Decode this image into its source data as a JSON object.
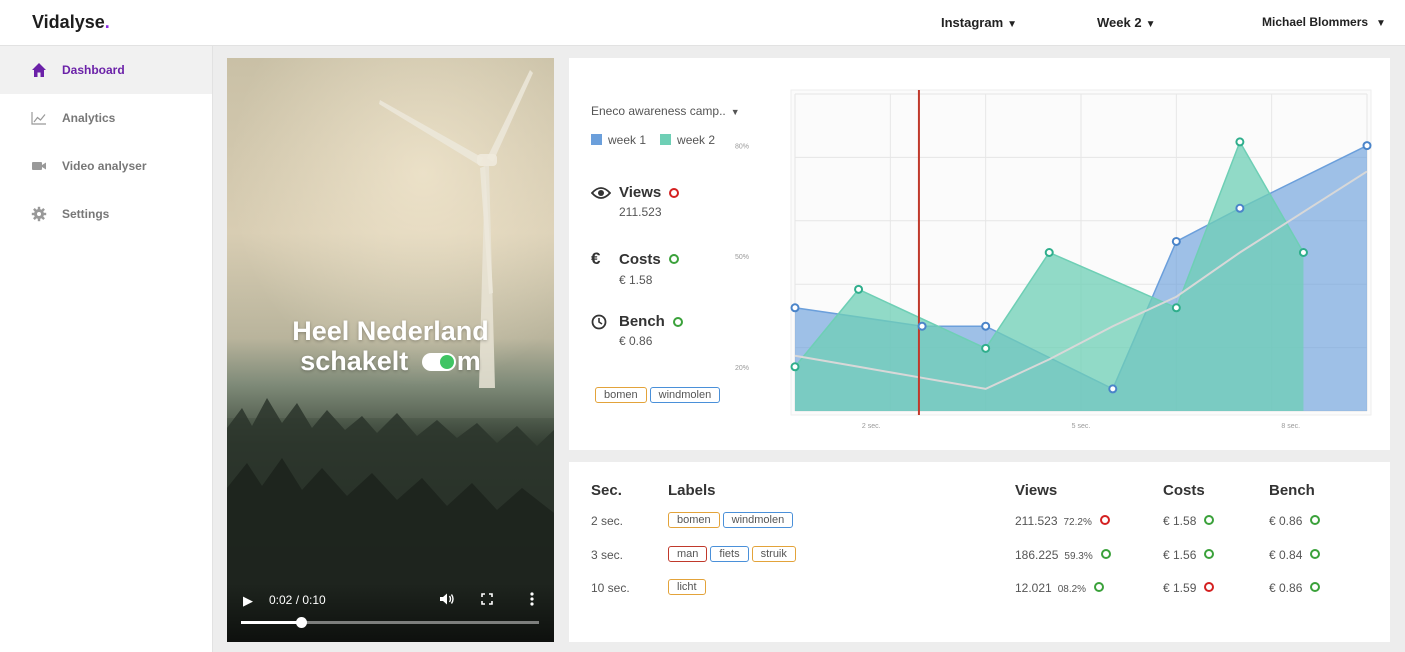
{
  "app": {
    "brand": "Vidalyse",
    "brand_dot": "."
  },
  "topbar": {
    "platform": "Instagram",
    "week": "Week 2",
    "user": "Michael Blommers"
  },
  "sidebar": {
    "items": [
      {
        "label": "Dashboard",
        "icon": "home-icon",
        "active": true
      },
      {
        "label": "Analytics",
        "icon": "chart-line-icon",
        "active": false
      },
      {
        "label": "Video analyser",
        "icon": "video-camera-icon",
        "active": false
      },
      {
        "label": "Settings",
        "icon": "gear-icon",
        "active": false
      }
    ]
  },
  "video": {
    "title_line1": "Heel Nederland",
    "title_line2": "schakelt",
    "title_line2_end": "m",
    "time": "0:02 / 0:10",
    "progress": 0.2
  },
  "panel": {
    "campaign": "Eneco awareness camp..",
    "metrics": [
      {
        "label": "Views",
        "icon": "eye-icon",
        "value": "211.523",
        "trend": "down"
      },
      {
        "label": "Costs",
        "icon": "euro-icon",
        "value": "€ 1.58",
        "trend": "up"
      },
      {
        "label": "Bench",
        "icon": "clock-icon",
        "value": "€ 0.86",
        "trend": "up"
      }
    ],
    "tags": [
      "bomen",
      "windmolen"
    ]
  },
  "colors": {
    "week1": "#6b9fdb",
    "week2": "#6ecfb5",
    "accent": "#6b21a8",
    "marker": "#c0392b",
    "up": "#3aa13a",
    "down": "#d42020"
  },
  "chart_data": {
    "type": "area",
    "legend": [
      "week 1",
      "week 2"
    ],
    "x": [
      1,
      2,
      3,
      4,
      5,
      6,
      7,
      8,
      9,
      10
    ],
    "xtick_labels": [
      {
        "x": 2.2,
        "label": "2 sec."
      },
      {
        "x": 5.5,
        "label": "5 sec."
      },
      {
        "x": 8.8,
        "label": "8 sec."
      }
    ],
    "ytick_labels": [
      {
        "y": 20,
        "label": "20%"
      },
      {
        "y": 50,
        "label": "50%"
      },
      {
        "y": 80,
        "label": "80%"
      }
    ],
    "ylim": [
      8,
      94
    ],
    "series": [
      {
        "name": "week 1",
        "values": [
          36,
          null,
          31,
          31,
          null,
          14,
          54,
          63,
          null,
          80
        ]
      },
      {
        "name": "week 2",
        "values": [
          20,
          41,
          null,
          25,
          51,
          null,
          36,
          81,
          51
        ]
      },
      {
        "name": "average",
        "values": [
          23,
          20,
          17,
          14,
          22,
          31,
          39,
          51,
          62,
          73
        ]
      }
    ],
    "current_marker_x": 2.95,
    "grid": true
  },
  "table": {
    "headers": {
      "sec": "Sec.",
      "labels": "Labels",
      "views": "Views",
      "costs": "Costs",
      "bench": "Bench"
    },
    "rows": [
      {
        "sec": "2 sec.",
        "labels": [
          [
            "bomen",
            "orange"
          ],
          [
            "windmolen",
            "blue"
          ]
        ],
        "views": "211.523",
        "pct": "72.2%",
        "views_trend": "down",
        "costs": "€ 1.58",
        "costs_trend": "up",
        "bench": "€ 0.86",
        "bench_trend": "up"
      },
      {
        "sec": "3 sec.",
        "labels": [
          [
            "man",
            "red"
          ],
          [
            "fiets",
            "blue"
          ],
          [
            "struik",
            "orange"
          ]
        ],
        "views": "186.225",
        "pct": "59.3%",
        "views_trend": "up",
        "costs": "€ 1.56",
        "costs_trend": "up",
        "bench": "€ 0.84",
        "bench_trend": "up"
      },
      {
        "sec": "10 sec.",
        "labels": [
          [
            "licht",
            "orange"
          ]
        ],
        "views": "12.021",
        "pct": "08.2%",
        "views_trend": "up",
        "costs": "€ 1.59",
        "costs_trend": "down",
        "bench": "€ 0.86",
        "bench_trend": "up"
      }
    ]
  }
}
